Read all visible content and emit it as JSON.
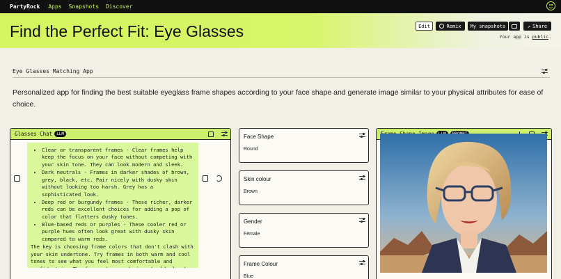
{
  "nav": {
    "brand": "PartyRock",
    "links": [
      "Apps",
      "Snapshots",
      "Discover"
    ],
    "profile_icon": "smiley-face-icon"
  },
  "header": {
    "title": "Find the Perfect Fit: Eye Glasses",
    "edit_label": "Edit",
    "remix_label": "Remix",
    "my_snapshots_label": "My snapshots",
    "share_label": "Share",
    "public_prefix": "Your app is ",
    "public_word": "public",
    "public_suffix": ".",
    "accent_color": "#d5f55e"
  },
  "app": {
    "subtitle": "Eye Glasses Matching App",
    "description": "Personalized app for finding the best suitable eyeglass frame shapes according to your face shape and generate image similar to your physical attributes for ease of choice."
  },
  "chat": {
    "title": "Glasses Chat",
    "badge": "LLM",
    "items": [
      "Clear or transparent frames - Clear frames help keep the focus on your face without competing with your skin tone. They can look modern and sleek.",
      "Dark neutrals - Frames in darker shades of brown, grey, black, etc. Pair nicely with dusky skin without looking too harsh. Grey has a sophisticated look.",
      "Deep red or burgundy frames - These richer, darker reds can be excellent choices for adding a pop of color that flatters dusky tones.",
      "Blue-based reds or purples - These cooler red or purple hues often look great with dusky skin compared to warm reds."
    ],
    "closing": "The key is choosing frame colors that don't clash with your skin undertone. Try frames in both warm and cool tones to see what you feel most comfortable and confident in. The frame shape and size should also be suited to your facial features."
  },
  "inputs": [
    {
      "label": "Face Shape",
      "value": "Round"
    },
    {
      "label": "Skin colour",
      "value": "Brown"
    },
    {
      "label": "Gender",
      "value": "Female"
    },
    {
      "label": "Frame Colour",
      "value": "Blue"
    }
  ],
  "image_widget": {
    "title": "Frame Shape Image",
    "badge_llm": "LLM",
    "badge_prompt": "PROMPT"
  }
}
